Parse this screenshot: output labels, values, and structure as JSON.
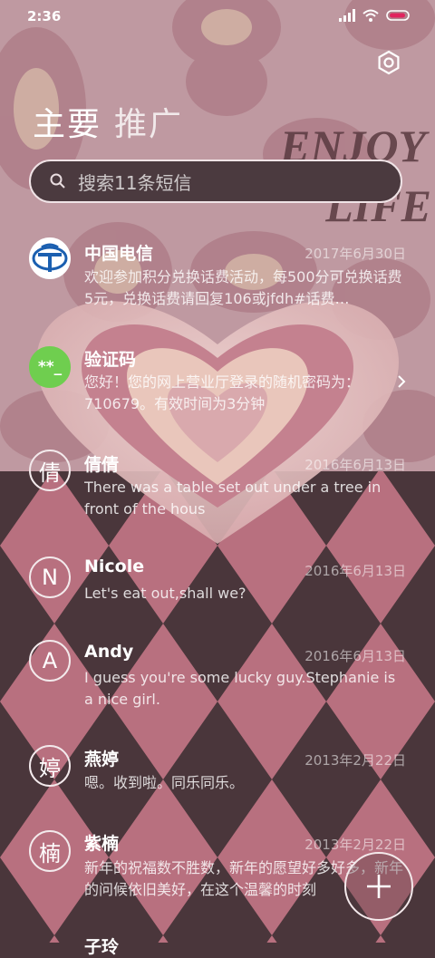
{
  "status_bar": {
    "time": "2:36"
  },
  "background": {
    "text_line1": "ENJOY",
    "text_line2": "LIFE"
  },
  "tabs": [
    {
      "label": "主要"
    },
    {
      "label": "推广"
    }
  ],
  "search": {
    "placeholder": "搜索11条短信"
  },
  "conversations": [
    {
      "name": "中国电信",
      "date": "2017年6月30日",
      "preview": "欢迎参加积分兑换话费活动，每500分可兑换话费5元，兑换话费请回复106或jfdh#话费…",
      "avatar": "china-telecom-logo"
    },
    {
      "name": "验证码",
      "date": "",
      "preview": "您好！您的网上营业厅登录的随机密码为：710679。有效时间为3分钟",
      "avatar_text": "**_"
    },
    {
      "name": "倩倩",
      "date": "2016年6月13日",
      "preview": "There was a table set out under a tree in front of the hous",
      "avatar_text": "倩"
    },
    {
      "name": "Nicole",
      "date": "2016年6月13日",
      "preview": "Let's eat out,shall we?",
      "avatar_text": "N"
    },
    {
      "name": "Andy",
      "date": "2016年6月13日",
      "preview": "I guess you're some lucky guy.Stephanie is a nice girl.",
      "avatar_text": "A"
    },
    {
      "name": "燕婷",
      "date": "2013年2月22日",
      "preview": "嗯。收到啦。同乐同乐。",
      "avatar_text": "婷"
    },
    {
      "name": "紫楠",
      "date": "2013年2月22日",
      "preview": "新年的祝福数不胜数，新年的愿望好多好多，新年的问候依旧美好，在这个温馨的时刻",
      "avatar_text": "楠"
    },
    {
      "name": "子玲",
      "date": "",
      "preview": "",
      "avatar_text": ""
    }
  ],
  "colors": {
    "accent_green": "#6fce4f",
    "telecom_blue": "#1b5fb0",
    "pink": "#b9727f",
    "dark": "#4a363b"
  }
}
